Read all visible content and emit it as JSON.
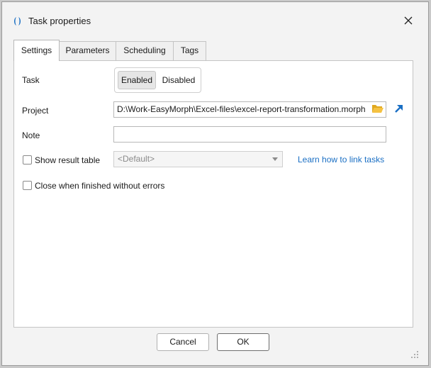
{
  "window": {
    "title": "Task properties",
    "accent_color": "#1a6fc4"
  },
  "tabs": [
    {
      "label": "Settings",
      "active": true
    },
    {
      "label": "Parameters",
      "active": false
    },
    {
      "label": "Scheduling",
      "active": false
    },
    {
      "label": "Tags",
      "active": false
    }
  ],
  "settings": {
    "task_label": "Task",
    "task_options": [
      "Enabled",
      "Disabled"
    ],
    "task_selected": "Enabled",
    "project_label": "Project",
    "project_value": "D:\\Work-EasyMorph\\Excel-files\\excel-report-transformation.morph",
    "note_label": "Note",
    "note_value": "",
    "show_result_table_label": "Show result table",
    "show_result_table_checked": false,
    "result_table_combo_value": "<Default>",
    "learn_link_label": "Learn how to link tasks",
    "close_when_finished_label": "Close when finished without errors",
    "close_when_finished_checked": false
  },
  "footer": {
    "cancel_label": "Cancel",
    "ok_label": "OK"
  },
  "icons": {
    "app_logo": "easymorph-logo-icon",
    "close": "close-icon",
    "folder": "folder-open-icon",
    "open_project": "arrow-up-left-icon",
    "combo_arrow": "chevron-down-icon",
    "grip": "resize-grip-icon"
  }
}
